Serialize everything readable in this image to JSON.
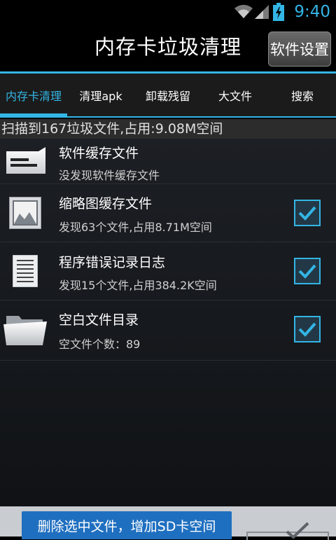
{
  "status_bar": {
    "time": "9:40"
  },
  "header": {
    "title": "内存卡垃圾清理",
    "settings_button": "软件设置"
  },
  "tabs": [
    {
      "label": "内存卡清理",
      "active": true
    },
    {
      "label": "清理apk",
      "active": false
    },
    {
      "label": "卸载残留",
      "active": false
    },
    {
      "label": "大文件",
      "active": false
    },
    {
      "label": "搜索",
      "active": false
    }
  ],
  "summary": "扫描到167垃圾文件,占用:9.08M空间",
  "items": [
    {
      "title": "软件缓存文件",
      "subtitle": "没发现软件缓存文件",
      "icon": "app-cache-icon",
      "checked": null
    },
    {
      "title": "缩略图缓存文件",
      "subtitle": "发现63个文件,占用8.71M空间",
      "icon": "image-thumbnail-icon",
      "checked": true
    },
    {
      "title": "程序错误记录日志",
      "subtitle": "发现15个文件,占用384.2K空间",
      "icon": "log-document-icon",
      "checked": true
    },
    {
      "title": "空白文件目录",
      "subtitle": "空文件个数：89",
      "icon": "folder-icon",
      "checked": true
    }
  ],
  "bottom": {
    "delete_button": "删除选中文件，增加SD卡空间"
  },
  "colors": {
    "accent": "#33b5e5",
    "button_blue": "#1f6fc0"
  }
}
